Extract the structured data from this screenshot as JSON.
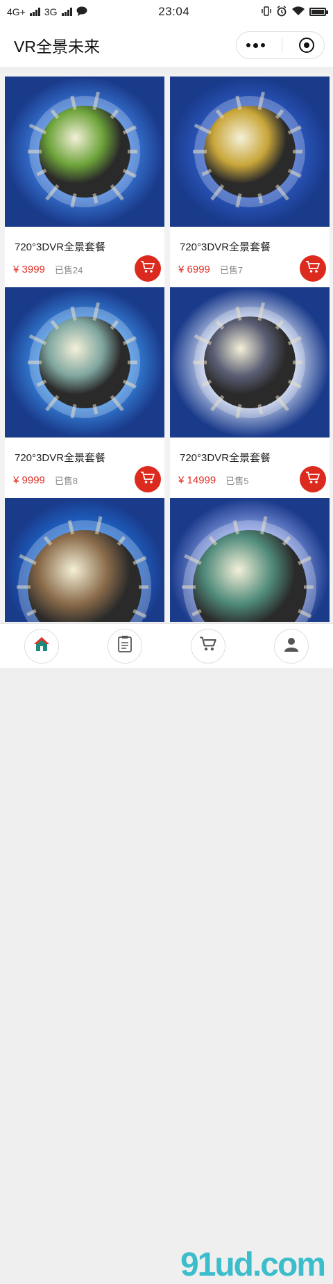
{
  "status": {
    "network1": "4G+",
    "network2": "3G",
    "time": "23:04"
  },
  "navbar": {
    "title": "VR全景未来"
  },
  "products": [
    {
      "name": "720°3DVR全景套餐",
      "price": "¥ 3999",
      "sold": "已售24",
      "sky": "#3c7fe0",
      "planet": "#6da43a"
    },
    {
      "name": "720°3DVR全景套餐",
      "price": "¥ 6999",
      "sold": "已售7",
      "sky": "#2d5cc7",
      "planet": "#c9a63a"
    },
    {
      "name": "720°3DVR全景套餐",
      "price": "¥ 9999",
      "sold": "已售8",
      "sky": "#3a8ee6",
      "planet": "#7fa6a0"
    },
    {
      "name": "720°3DVR全景套餐",
      "price": "¥ 14999",
      "sold": "已售5",
      "sky": "#c9d5ef",
      "planet": "#5a5e74"
    },
    {
      "name": "",
      "price": "",
      "sold": "",
      "sky": "#1f6fd6",
      "planet": "#8a6b4a"
    },
    {
      "name": "",
      "price": "",
      "sold": "",
      "sky": "#8aa0e6",
      "planet": "#4f8a7a"
    }
  ],
  "colors": {
    "accent": "#dd2a1f",
    "price": "#e0322a"
  },
  "tabbar": {
    "icons": [
      "home-icon",
      "order-list-icon",
      "cart-icon",
      "profile-icon"
    ]
  },
  "watermark": "91ud.com"
}
